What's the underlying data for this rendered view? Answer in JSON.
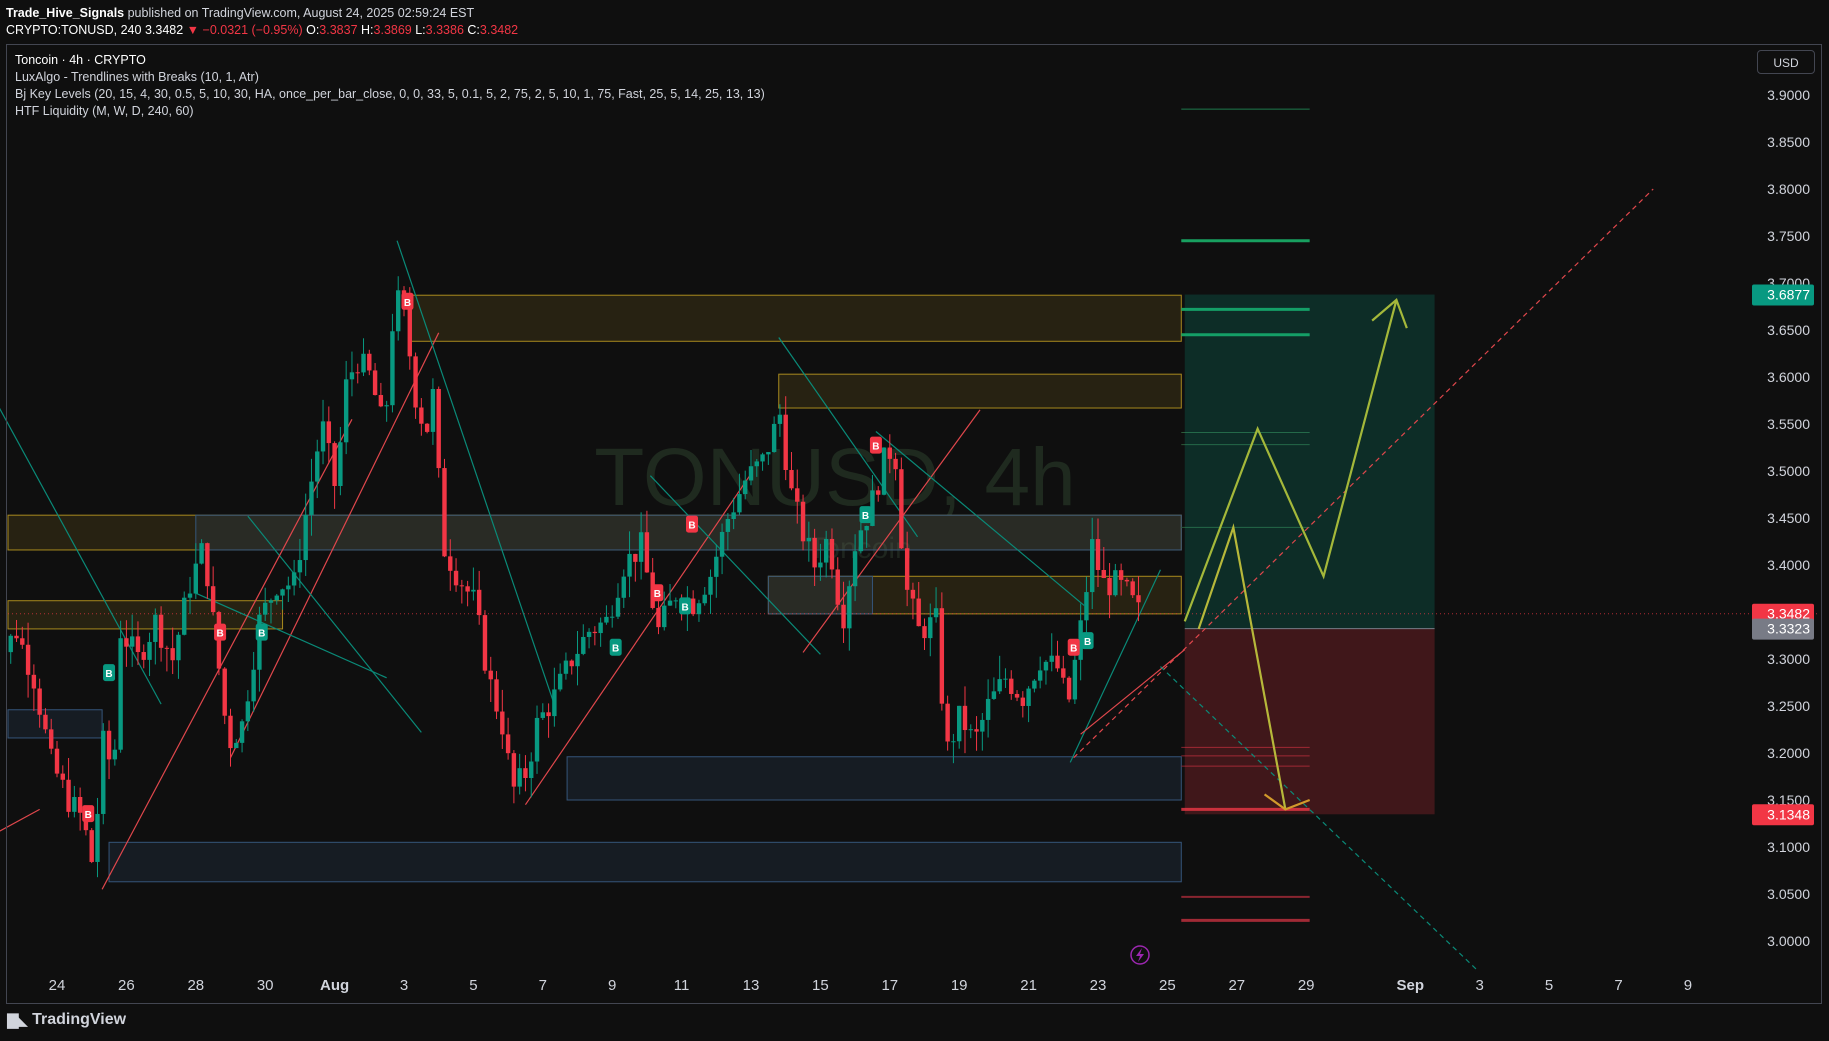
{
  "header": {
    "author": "Trade_Hive_Signals",
    "published": " published on TradingView.com, August 24, 2025 02:59:24 EST",
    "symbol": "CRYPTO:TONUSD, 240",
    "last": "3.3482",
    "change": "−0.0321 (−0.95%)",
    "o_label": "O:",
    "o": "3.3837",
    "h_label": "H:",
    "h": "3.3869",
    "l_label": "L:",
    "l": "3.3386",
    "c_label": "C:",
    "c": "3.3482"
  },
  "legend": {
    "title": "Toncoin · 4h · CRYPTO",
    "ind1": "LuxAlgo - Trendlines with Breaks (10, 1, Atr)",
    "ind2": "Bj Key Levels (20, 15, 4, 30, 0.5, 5, 10, 30, HA, once_per_bar_close, 0, 0, 33, 5, 0.1, 5, 2, 75, 2, 5, 10, 1, 75, Fast, 25, 5, 14, 25, 13, 13)",
    "ind3": "HTF Liquidity (M, W, D, 240, 60)"
  },
  "currency": "USD",
  "watermark": {
    "symbol": "TONUSD, 4h",
    "name": "Toncoin"
  },
  "footer": {
    "brand": "TradingView"
  },
  "colors": {
    "up": "#089981",
    "down": "#f23645",
    "zone_yellow": "#c9a227",
    "zone_blue": "#3a5a80",
    "target": "#0c8c6e",
    "stop": "#8a2530",
    "arrow": "#a4b83a",
    "arrow_down": "#d29a2b"
  },
  "chart_data": {
    "type": "candlestick",
    "x_ticks": [
      "24",
      "26",
      "28",
      "30",
      "Aug",
      "3",
      "5",
      "7",
      "9",
      "11",
      "13",
      "15",
      "17",
      "19",
      "21",
      "23",
      "25",
      "27",
      "29",
      "Sep",
      "3",
      "5",
      "7",
      "9"
    ],
    "y_ticks": [
      "3.9000",
      "3.8500",
      "3.8000",
      "3.7500",
      "3.7000",
      "3.6500",
      "3.6000",
      "3.5500",
      "3.5000",
      "3.4500",
      "3.4000",
      "3.3500",
      "3.3000",
      "3.2500",
      "3.2000",
      "3.1500",
      "3.1000",
      "3.0500",
      "3.0000"
    ],
    "ylim": [
      2.97,
      3.94
    ],
    "price_badges": [
      {
        "value": "3.6877",
        "color": "#089981"
      },
      {
        "value": "3.3482",
        "color": "#f23645"
      },
      {
        "value": "3.3323",
        "color": "#787b86"
      },
      {
        "value": "3.1348",
        "color": "#f23645"
      }
    ],
    "position": {
      "entry": 3.3323,
      "target": 3.6877,
      "stop": 3.1348
    },
    "signals": [
      {
        "label": "B",
        "type": "buy",
        "day": 25.5,
        "price": 3.285
      },
      {
        "label": "B",
        "type": "sell",
        "day": 24.9,
        "price": 3.135
      },
      {
        "label": "B",
        "type": "sell",
        "day": 28.7,
        "price": 3.328
      },
      {
        "label": "B",
        "type": "buy",
        "day": 29.9,
        "price": 3.328
      },
      {
        "label": "B",
        "type": "sell",
        "day": 34.1,
        "price": 3.68
      },
      {
        "label": "B",
        "type": "buy",
        "day": 40.1,
        "price": 3.312
      },
      {
        "label": "B",
        "type": "sell",
        "day": 41.3,
        "price": 3.37
      },
      {
        "label": "B",
        "type": "buy",
        "day": 42.1,
        "price": 3.356
      },
      {
        "label": "B",
        "type": "sell",
        "day": 42.3,
        "price": 3.443
      },
      {
        "label": "B",
        "type": "buy",
        "day": 47.3,
        "price": 3.453
      },
      {
        "label": "B",
        "type": "sell",
        "day": 47.6,
        "price": 3.527
      },
      {
        "label": "B",
        "type": "sell",
        "day": 53.3,
        "price": 3.312
      },
      {
        "label": "B",
        "type": "buy",
        "day": 53.7,
        "price": 3.319
      }
    ]
  }
}
